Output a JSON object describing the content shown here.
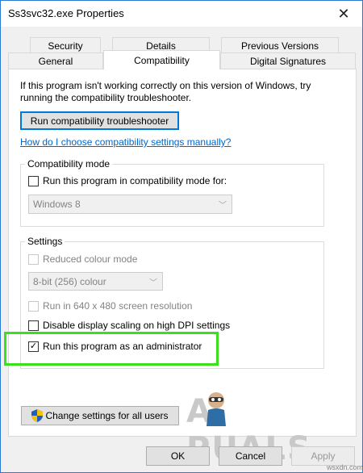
{
  "window": {
    "title": "Ss3svc32.exe Properties"
  },
  "tabs": {
    "row1": [
      "Security",
      "Details",
      "Previous Versions"
    ],
    "row2": [
      "General",
      "Compatibility",
      "Digital Signatures"
    ]
  },
  "intro": {
    "text": "If this program isn't working correctly on this version of Windows, try running the compatibility troubleshooter."
  },
  "troubleshooter_button": "Run compatibility troubleshooter",
  "help_link": "How do I choose compatibility settings manually?",
  "compatibility_mode": {
    "label": "Compatibility mode",
    "checkbox_label": "Run this program in compatibility mode for:",
    "select_value": "Windows 8"
  },
  "settings": {
    "label": "Settings",
    "reduced_colour": "Reduced colour mode",
    "colour_select": "8-bit (256) colour",
    "run_640": "Run in 640 x 480 screen resolution",
    "disable_scaling": "Disable display scaling on high DPI settings",
    "run_admin": "Run this program as an administrator"
  },
  "change_settings_button": "Change settings for all users",
  "footer": {
    "ok": "OK",
    "cancel": "Cancel",
    "apply": "Apply"
  },
  "watermark": {
    "left": "A",
    "right": "PUALS"
  },
  "credit": "wsxdn.com",
  "colors": {
    "accent": "#0078d7",
    "link": "#0066cc",
    "highlight": "#39e01b"
  }
}
